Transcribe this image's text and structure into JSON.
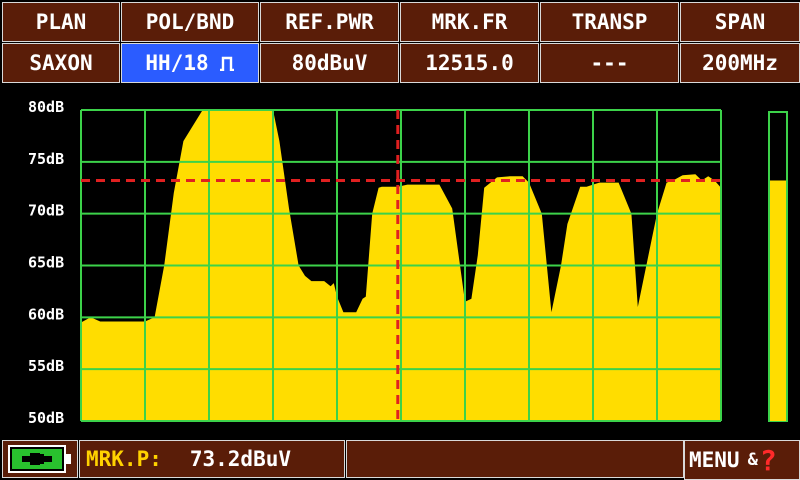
{
  "header": {
    "labels": [
      "PLAN",
      "POL/BND",
      "REF.PWR",
      "MRK.FR",
      "TRANSP",
      "SPAN"
    ],
    "values": [
      "SAXON",
      "HH/18",
      "80dBuV",
      "12515.0",
      "---",
      "200MHz"
    ],
    "selected_index": 1,
    "band_icon": "pulse-icon"
  },
  "chart_data": {
    "type": "area",
    "ylim": [
      50,
      80
    ],
    "yticks": [
      "80dB",
      "75dB",
      "70dB",
      "65dB",
      "60dB",
      "55dB",
      "50dB"
    ],
    "grid": true,
    "x": [
      0,
      0.015,
      0.03,
      0.07,
      0.1,
      0.115,
      0.13,
      0.145,
      0.16,
      0.19,
      0.22,
      0.3,
      0.31,
      0.325,
      0.34,
      0.35,
      0.36,
      0.38,
      0.39,
      0.395,
      0.4,
      0.41,
      0.415,
      0.43,
      0.44,
      0.445,
      0.455,
      0.465,
      0.47,
      0.48,
      0.495,
      0.51,
      0.52,
      0.53,
      0.55,
      0.56,
      0.58,
      0.6,
      0.61,
      0.62,
      0.63,
      0.65,
      0.67,
      0.69,
      0.7,
      0.72,
      0.735,
      0.75,
      0.76,
      0.78,
      0.79,
      0.8,
      0.81,
      0.84,
      0.86,
      0.87,
      0.89,
      0.9,
      0.915,
      0.925,
      0.94,
      0.96,
      0.97,
      0.98,
      0.99,
      1.0
    ],
    "y": [
      59.5,
      60.0,
      59.6,
      59.6,
      59.6,
      60.0,
      65.0,
      72.0,
      77.0,
      80.0,
      80.0,
      80.0,
      77.0,
      70.5,
      65.0,
      64.0,
      63.5,
      63.5,
      63.0,
      63.3,
      62.0,
      60.5,
      60.5,
      60.5,
      61.8,
      62.0,
      70.0,
      72.5,
      72.6,
      72.6,
      72.6,
      72.8,
      72.8,
      72.8,
      72.8,
      72.8,
      70.5,
      61.5,
      61.8,
      66.0,
      72.5,
      73.5,
      73.6,
      73.6,
      73.0,
      70.0,
      60.5,
      65.0,
      69.0,
      72.6,
      72.6,
      72.8,
      73.0,
      73.0,
      70.0,
      61.0,
      67.0,
      70.0,
      73.0,
      73.2,
      73.7,
      73.8,
      73.2,
      73.6,
      73.2,
      72.5
    ],
    "marker_x": 0.495,
    "marker_level": 73.2,
    "side_bar_level": 73.2,
    "colors": {
      "fill": "#ffdd00",
      "grid": "#3cd24a",
      "marker": "#e02020",
      "axis_text": "#ffffff"
    }
  },
  "footer": {
    "battery_icon": "battery-charging-icon",
    "mrk_label": "MRK.P:",
    "mrk_value": "73.2dBuV",
    "menu_label": "MENU",
    "menu_amp": "&",
    "menu_q": "?"
  }
}
